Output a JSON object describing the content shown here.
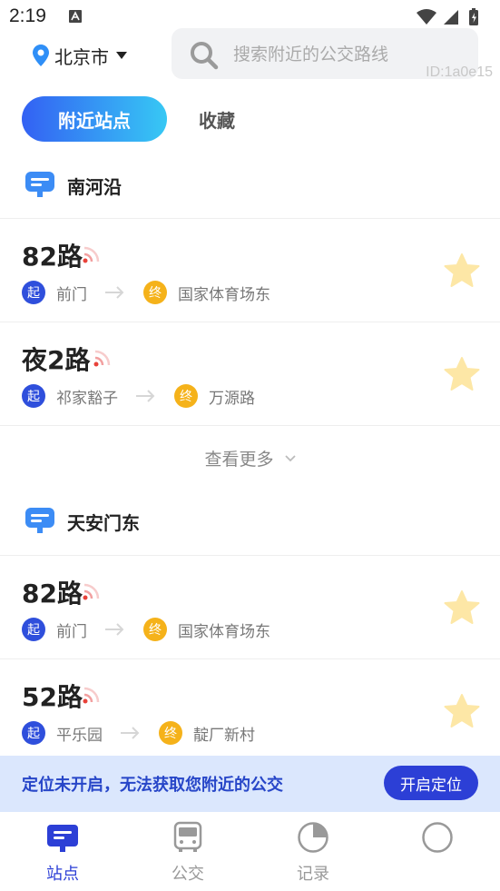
{
  "status_bar": {
    "time": "2:19"
  },
  "header": {
    "city": "北京市",
    "search_placeholder": "搜索附近的公交路线",
    "id_tag": "ID:1a0e15"
  },
  "tabs": [
    {
      "label": "附近站点",
      "active": true
    },
    {
      "label": "收藏",
      "active": false
    }
  ],
  "stations": [
    {
      "name": "南河沿",
      "routes": [
        {
          "name": "82路",
          "start": "前门",
          "end": "国家体育场东"
        },
        {
          "name": "夜2路",
          "start": "祁家豁子",
          "end": "万源路"
        }
      ],
      "more_label": "查看更多"
    },
    {
      "name": "天安门东",
      "routes": [
        {
          "name": "82路",
          "start": "前门",
          "end": "国家体育场东"
        },
        {
          "name": "52路",
          "start": "平乐园",
          "end": "靛厂新村"
        }
      ]
    }
  ],
  "badges": {
    "start": "起",
    "end": "终"
  },
  "notice": {
    "text": "定位未开启，无法获取您附近的公交",
    "button": "开启定位"
  },
  "bottom_nav": [
    {
      "label": "站点",
      "icon": "station-icon",
      "active": true
    },
    {
      "label": "公交",
      "icon": "bus-icon",
      "active": false
    },
    {
      "label": "记录",
      "icon": "record-icon",
      "active": false
    },
    {
      "label": "",
      "icon": "profile-icon",
      "active": false
    }
  ],
  "colors": {
    "primary": "#2c3fd6",
    "start_badge": "#2f4fdc",
    "end_badge": "#f5b21a",
    "star": "#fde7a6",
    "notice_bg": "#dbe7fd"
  }
}
